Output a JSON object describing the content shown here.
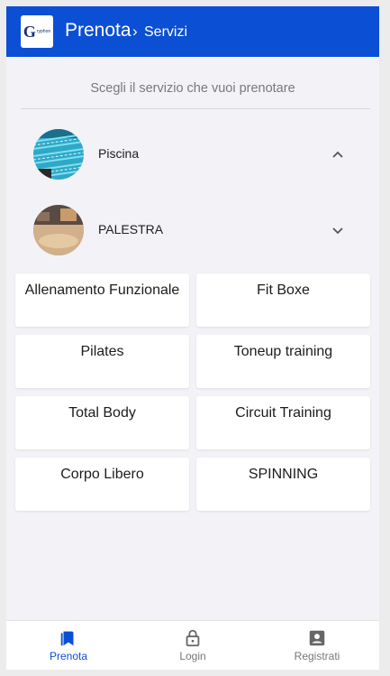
{
  "appbar": {
    "title": "Prenota",
    "separator": "›",
    "breadcrumb": "Servizi",
    "color": "#0b4fd4",
    "logo_text_main": "G",
    "logo_text_small": "ryphon"
  },
  "main": {
    "subtitle": "Scegli il servizio che vuoi prenotare"
  },
  "categories": [
    {
      "label": "Piscina",
      "expanded": true,
      "icon": "chevron-up-icon"
    },
    {
      "label": "PALESTRA",
      "expanded": false,
      "icon": "chevron-down-icon"
    }
  ],
  "services": [
    {
      "label": "Allenamento Funzionale"
    },
    {
      "label": "Fit Boxe"
    },
    {
      "label": "Pilates"
    },
    {
      "label": "Toneup training"
    },
    {
      "label": "Total Body"
    },
    {
      "label": "Circuit Training"
    },
    {
      "label": "Corpo Libero"
    },
    {
      "label": "SPINNING"
    }
  ],
  "bottom_nav": {
    "items": [
      {
        "label": "Prenota",
        "icon": "bookmark-icon",
        "active": true
      },
      {
        "label": "Login",
        "icon": "lock-icon",
        "active": false
      },
      {
        "label": "Registrati",
        "icon": "account-box-icon",
        "active": false
      }
    ]
  }
}
